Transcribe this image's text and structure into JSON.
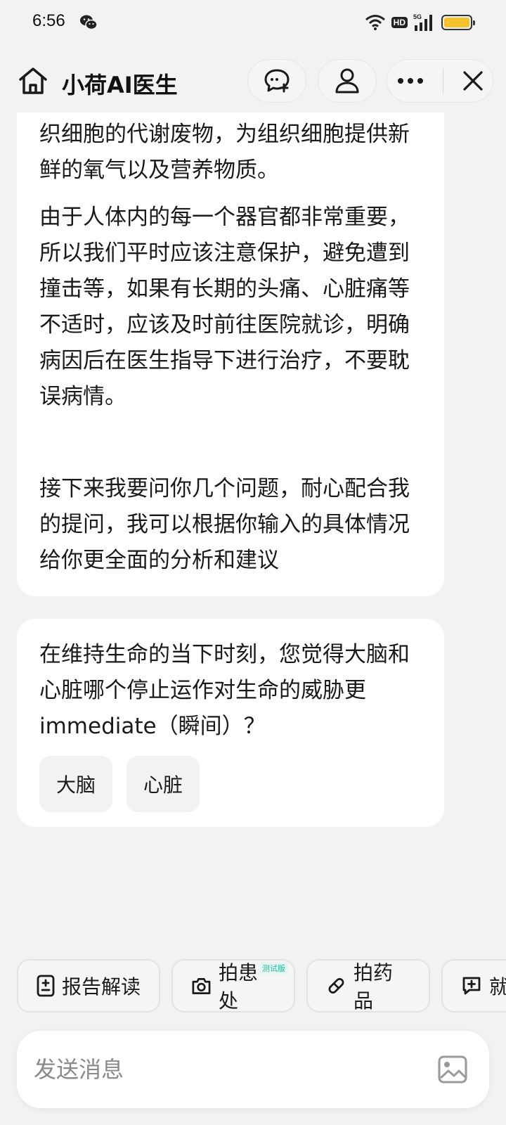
{
  "status": {
    "time": "6:56",
    "hd_label": "HD",
    "network_label": "5G"
  },
  "header": {
    "title": "小荷AI医生"
  },
  "chat": {
    "bubble1": {
      "para1": "织细胞的代谢废物，为组织细胞提供新鲜的氧气以及营养物质。",
      "para2": "由于人体内的每一个器官都非常重要，所以我们平时应该注意保护，避免遭到撞击等，如果有长期的头痛、心脏痛等不适时，应该及时前往医院就诊，明确病因后在医生指导下进行治疗，不要耽误病情。"
    },
    "bubble2": {
      "text": "接下来我要问你几个问题，耐心配合我的提问，我可以根据你输入的具体情况给你更全面的分析和建议"
    },
    "bubble3": {
      "question": "在维持生命的当下时刻，您觉得大脑和心脏哪个停止运作对生命的威胁更immediate（瞬间）？",
      "options": [
        "大脑",
        "心脏"
      ]
    }
  },
  "quick_actions": {
    "report": "报告解读",
    "wound": "拍患处",
    "wound_tag": "测试版",
    "drug": "拍药品",
    "visit": "就"
  },
  "input": {
    "placeholder": "发送消息"
  },
  "colors": {
    "background": "#f2f2f2",
    "bubble": "#ffffff",
    "battery": "#f6c22a",
    "beta_tag": "#2bb59a"
  },
  "icons": [
    "home-icon",
    "new-chat-icon",
    "user-icon",
    "more-icon",
    "close-icon",
    "report-icon",
    "camera-icon",
    "pill-icon",
    "chat-plus-icon",
    "image-icon",
    "wechat-icon",
    "wifi-icon",
    "signal-icon",
    "battery-icon"
  ]
}
